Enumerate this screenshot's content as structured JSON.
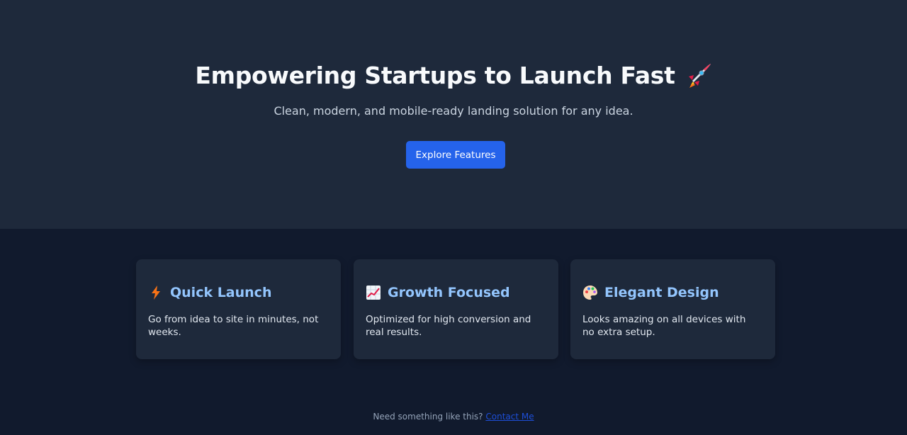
{
  "hero": {
    "title": "Empowering Startups to Launch Fast",
    "title_icon": "rocket-icon",
    "subtitle": "Clean, modern, and mobile-ready landing solution for any idea.",
    "cta_label": "Explore Features"
  },
  "features": [
    {
      "icon": "lightning-icon",
      "title": "Quick Launch",
      "text": "Go from idea to site in minutes, not weeks."
    },
    {
      "icon": "chart-increasing-icon",
      "title": "Growth Focused",
      "text": "Optimized for high conversion and real results."
    },
    {
      "icon": "palette-icon",
      "title": "Elegant Design",
      "text": "Looks amazing on all devices with no extra setup."
    }
  ],
  "footer": {
    "text": "Need something like this?",
    "link_label": "Contact Me"
  },
  "colors": {
    "hero_bg": "#1e293b",
    "page_bg": "#111a2d",
    "accent": "#2563eb",
    "card_title": "#93c5fd"
  }
}
